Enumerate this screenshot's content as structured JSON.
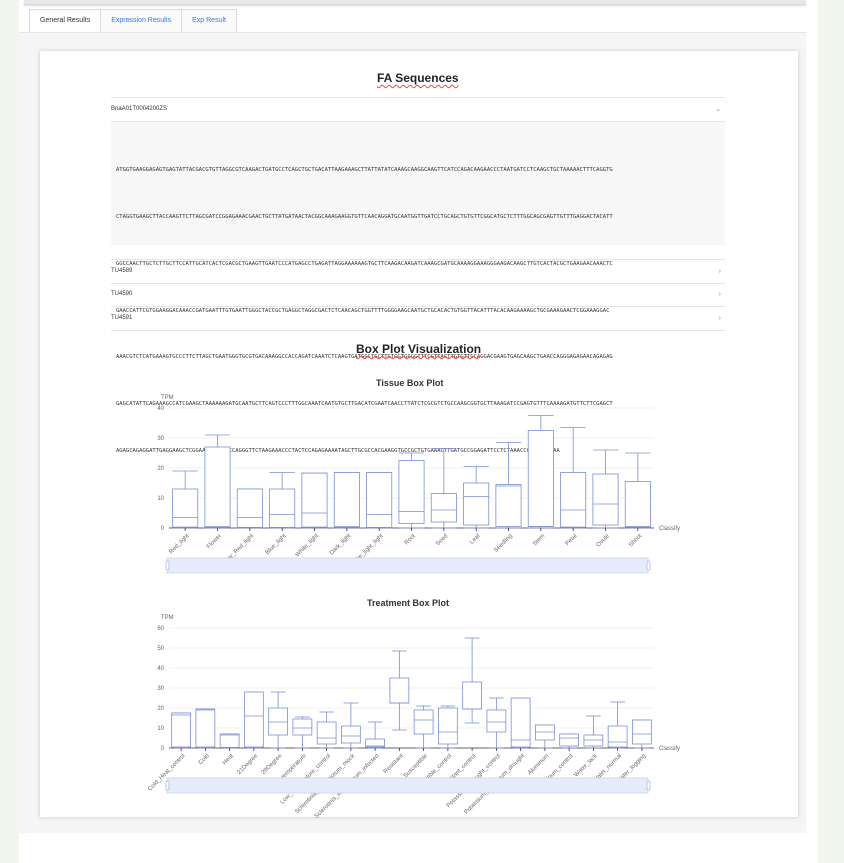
{
  "tabs": [
    {
      "label": "General Results",
      "active": true
    },
    {
      "label": "Expression Results",
      "active": false
    },
    {
      "label": "Exp Result",
      "active": false
    }
  ],
  "fa_sequences": {
    "title": "FA Sequences",
    "expanded_item": "BnaA01T0004200ZS",
    "sequence_lines": [
      "ATGGTGAAGGAGAGTGAGTATTACGACGTGTTAGGCGTCAAGACTGATGCCTCAGCTGCTGACATTAAGAAAGCTTATTATATCAAAGCAAGGCAAGTTCATCCAGACAAGAACCCTAATGATCCTCAAGCTGCTAAAAACTTTCAGGTG",
      "CTAGGTGAAGCTTACCAAGTTCTTAGCGATCCGGAGAAACGAACTGCTTATGATAACTACGGCAAAGAAGGTGTTCAACAGGATGCAATGGTTGATCCTGCAGCTGTGTTCGGCATGCTCTTTGGCAGCGAGTTGTTTGAGGACTACATT",
      "GGCCAACTTGCTCTTGCTTCCATTGCATCACTCGACGCTGAAGTTGAATCCCATGAGCCTGAGATTAGGAAAAAAGTGCTTCAAGACAAGATCAAAGCGATGCAAAAGGAAAGGGAAGACAAGCTTGTCACTACGCTGAAGAACAAACTC",
      "GAACCATTCGTGGAAGGACAAACCGATGAATTTGTGAATTGGGCTACCGCTGAGGCTAGGCGACTCTCAACAGCTGGTTTTGGGGAAGCAATGCTGCACACTGTGGTTACATTTACACAAGAAAAGCTGCGAAAGAACTCGGAAAGGAC",
      "AAACGTCTCATGAAAGTGCCCTTCTTAGCTGAATGGGTGCGTGACAAAGGCCACCAGATCAAATCTCAAGTGATGGCTGCTTCTGGTGCGGTTTCGTTACTTGTGTTGCAGGACGAAGTGAGCAAGCTGAACCAGGGAGAGAACAGAGAG",
      "GAGCATATTCAGAAAGCCATCGAAGCTAAAAAAGATGCAATGCTTCAGTCCCTTTGGCAAATCAATGTGCTTGACATCGAATCAACCTTATCTCGCGTCTGCCAAGCGGTGCTTAAAGATCCGAGTGTTTCAAAAGATGTTCTTCGAGCT",
      "AGAGCAGAGGATTGAGGAAGCTCGGAAACATTTTCCAGGGTTCTAAGAAACCCTACTCCAGAGAAAATAGCTTGCGCCACGAAGGTGCCGCTGTGAAACTTGATGCCGGAGATTCCTCTAAACCGGCGACTTAA"
    ],
    "collapsed_items": [
      "TU4589",
      "TU4590",
      "TU4591"
    ]
  },
  "box_plot_section": {
    "title": "Box Plot Visualization"
  },
  "chart_data": [
    {
      "type": "box",
      "title": "Tissue Box Plot",
      "ylabel": "TPM",
      "xlabel": "Classify",
      "ylim": [
        0,
        40
      ],
      "yticks": [
        0,
        10,
        20,
        30,
        40
      ],
      "grid": true,
      "series": [
        {
          "name": "",
          "color": "#7b8fd4"
        }
      ],
      "categories": [
        "Red_light",
        "Flower",
        "Far_Red_light",
        "Blue_light",
        "White_light",
        "Dark_light",
        "White_light_light",
        "Root",
        "Seed",
        "Leaf",
        "Seedling",
        "Stem",
        "Petal",
        "Ovule",
        "Shoot"
      ],
      "boxes": [
        {
          "min": 0,
          "q1": 0.3,
          "median": 3.5,
          "q3": 13,
          "max": 19
        },
        {
          "min": 0,
          "q1": 0.2,
          "median": 0.5,
          "q3": 27,
          "max": 31
        },
        {
          "min": 0,
          "q1": 0.2,
          "median": 3.5,
          "q3": 13,
          "max": 13
        },
        {
          "min": 0,
          "q1": 0.2,
          "median": 4.5,
          "q3": 13,
          "max": 18.5
        },
        {
          "min": 0,
          "q1": 0.3,
          "median": 5,
          "q3": 18.3,
          "max": 18.3
        },
        {
          "min": 0,
          "q1": 0.2,
          "median": 0.5,
          "q3": 18.5,
          "max": 18.5
        },
        {
          "min": 0,
          "q1": 0.2,
          "median": 4.5,
          "q3": 18.5,
          "max": 18.5
        },
        {
          "min": 0,
          "q1": 1.5,
          "median": 5.5,
          "q3": 22.5,
          "max": 25
        },
        {
          "min": 0,
          "q1": 2,
          "median": 6,
          "q3": 11.5,
          "max": 26.5
        },
        {
          "min": 0,
          "q1": 1,
          "median": 10.5,
          "q3": 15,
          "max": 20.5
        },
        {
          "min": 0,
          "q1": 0.5,
          "median": 14,
          "q3": 14.5,
          "max": 28.5
        },
        {
          "min": 0,
          "q1": 0.5,
          "median": 0.5,
          "q3": 32.5,
          "max": 37.5
        },
        {
          "min": 0,
          "q1": 0.3,
          "median": 6,
          "q3": 18.5,
          "max": 33.5
        },
        {
          "min": 0,
          "q1": 1,
          "median": 8,
          "q3": 18,
          "max": 26
        },
        {
          "min": 0,
          "q1": 0.3,
          "median": 0.5,
          "q3": 15.5,
          "max": 25
        }
      ]
    },
    {
      "type": "box",
      "title": "Treatment Box Plot",
      "ylabel": "TPM",
      "xlabel": "Classify",
      "ylim": [
        0,
        60
      ],
      "yticks": [
        0,
        10,
        20,
        30,
        40,
        50,
        60
      ],
      "grid": true,
      "series": [
        {
          "name": "",
          "color": "#7b8fd4"
        }
      ],
      "categories": [
        "Cold_Heat_control",
        "Cold",
        "Heat",
        "21Degree",
        "29Degree",
        "Low_temperature",
        "Low_temperature_control",
        "Sclerotinia_sclerotiorum_mock",
        "Sclerotinia_sclerotiorum_infected",
        "Resistant",
        "Susceptible",
        "Susceptible_control",
        "Resistant_control",
        "Potassium_drought_control",
        "Potassium_potassium_drought",
        "Aluminum",
        "Aluminum_control",
        "Water_lack",
        "Water_normal",
        "Water_logging"
      ],
      "boxes": [
        {
          "min": 0,
          "q1": 0.5,
          "median": 16.5,
          "q3": 17.5,
          "max": 17.5
        },
        {
          "min": 0,
          "q1": 0.5,
          "median": 19,
          "q3": 19.5,
          "max": 19.5
        },
        {
          "min": 0,
          "q1": 0.3,
          "median": 6.5,
          "q3": 7,
          "max": 7
        },
        {
          "min": 0,
          "q1": 0.5,
          "median": 16,
          "q3": 28,
          "max": 28
        },
        {
          "min": 0,
          "q1": 6.5,
          "median": 13,
          "q3": 20,
          "max": 28
        },
        {
          "min": 0,
          "q1": 6.5,
          "median": 10,
          "q3": 14.5,
          "max": 15.5
        },
        {
          "min": 0,
          "q1": 2,
          "median": 5,
          "q3": 13,
          "max": 18
        },
        {
          "min": 0,
          "q1": 2.5,
          "median": 6,
          "q3": 11,
          "max": 22.5
        },
        {
          "min": 0,
          "q1": 0.5,
          "median": 1,
          "q3": 4.5,
          "max": 13
        },
        {
          "min": 9,
          "q1": 22.5,
          "median": 22.5,
          "q3": 35,
          "max": 48.5
        },
        {
          "min": 0,
          "q1": 7,
          "median": 14,
          "q3": 19,
          "max": 21
        },
        {
          "min": 0,
          "q1": 2,
          "median": 8,
          "q3": 20,
          "max": 21
        },
        {
          "min": 12.5,
          "q1": 19.5,
          "median": 19.5,
          "q3": 33,
          "max": 55
        },
        {
          "min": 0,
          "q1": 8,
          "median": 13,
          "q3": 19,
          "max": 25
        },
        {
          "min": 0,
          "q1": 0.5,
          "median": 4,
          "q3": 25,
          "max": 25
        },
        {
          "min": 0,
          "q1": 4,
          "median": 8,
          "q3": 11.5,
          "max": 11.5
        },
        {
          "min": 0,
          "q1": 1,
          "median": 5,
          "q3": 7,
          "max": 7
        },
        {
          "min": 0,
          "q1": 1,
          "median": 4,
          "q3": 6.5,
          "max": 16
        },
        {
          "min": 0,
          "q1": 0.5,
          "median": 3,
          "q3": 11,
          "max": 23
        },
        {
          "min": 0,
          "q1": 2,
          "median": 7,
          "q3": 14,
          "max": 14
        }
      ]
    }
  ]
}
